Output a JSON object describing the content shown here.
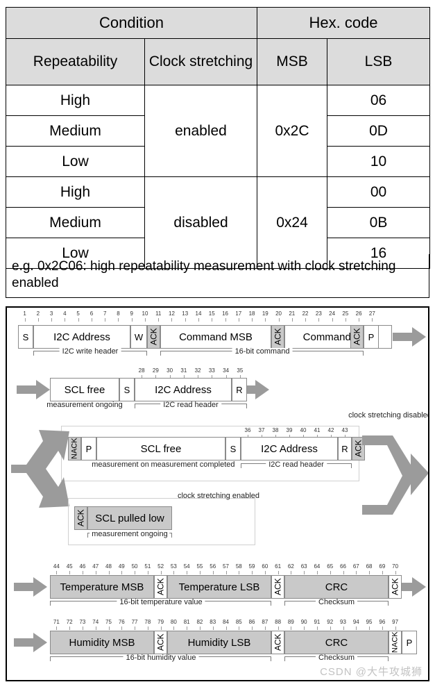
{
  "table": {
    "group_headers": [
      "Condition",
      "Hex. code"
    ],
    "column_headers": [
      "Repeatability",
      "Clock stretching",
      "MSB",
      "LSB"
    ],
    "rows": [
      {
        "repeatability": "High",
        "clock_stretching": "enabled",
        "msb": "0x2C",
        "lsb": "06"
      },
      {
        "repeatability": "Medium",
        "clock_stretching": "enabled",
        "msb": "0x2C",
        "lsb": "0D"
      },
      {
        "repeatability": "Low",
        "clock_stretching": "enabled",
        "msb": "0x2C",
        "lsb": "10"
      },
      {
        "repeatability": "High",
        "clock_stretching": "disabled",
        "msb": "0x24",
        "lsb": "00"
      },
      {
        "repeatability": "Medium",
        "clock_stretching": "disabled",
        "msb": "0x24",
        "lsb": "0B"
      },
      {
        "repeatability": "Low",
        "clock_stretching": "disabled",
        "msb": "0x24",
        "lsb": "16"
      }
    ],
    "note": "e.g. 0x2C06: high repeatability measurement with clock stretching enabled"
  },
  "diagram": {
    "row1": {
      "blocks": [
        "S",
        "I2C Address",
        "W",
        "ACK",
        "Command MSB",
        "ACK",
        "Command LSB",
        "ACK",
        "P"
      ],
      "bit_numbers": [
        "1",
        "2",
        "3",
        "4",
        "5",
        "6",
        "7",
        "8",
        "9",
        "10",
        "11",
        "12",
        "13",
        "14",
        "15",
        "16",
        "17",
        "18",
        "19",
        "20",
        "21",
        "22",
        "23",
        "24",
        "25",
        "26",
        "27"
      ],
      "brace_left": "I2C write header",
      "brace_right": "16-bit command"
    },
    "row2": {
      "blocks": [
        "SCL free",
        "S",
        "I2C Address",
        "R"
      ],
      "bit_numbers": [
        "28",
        "29",
        "30",
        "31",
        "32",
        "33",
        "34",
        "35"
      ],
      "brace_left": "measurement ongoing",
      "brace_right": "I2C read header"
    },
    "row3": {
      "blocks": [
        "NACK",
        "P",
        "SCL free",
        "S",
        "I2C Address",
        "R",
        "ACK"
      ],
      "bit_numbers": [
        "36",
        "37",
        "38",
        "39",
        "40",
        "41",
        "42",
        "43"
      ],
      "brace_a": "measurement ongoing",
      "brace_b": "measurement completed",
      "brace_c": "I2C read header",
      "callout": "clock stretching disabled"
    },
    "row4": {
      "blocks": [
        "ACK",
        "SCL pulled low"
      ],
      "brace_a": "measurement ongoing",
      "callout": "clock stretching enabled"
    },
    "row5": {
      "blocks": [
        "Temperature MSB",
        "ACK",
        "Temperature LSB",
        "ACK",
        "CRC",
        "ACK"
      ],
      "bit_numbers": [
        "44",
        "45",
        "46",
        "47",
        "48",
        "49",
        "50",
        "51",
        "52",
        "53",
        "54",
        "55",
        "56",
        "57",
        "58",
        "59",
        "60",
        "61",
        "62",
        "63",
        "64",
        "65",
        "66",
        "67",
        "68",
        "69",
        "70"
      ],
      "brace_left": "16-bit temperature value",
      "brace_right": "Checksum"
    },
    "row6": {
      "blocks": [
        "Humidity MSB",
        "ACK",
        "Humidity LSB",
        "ACK",
        "CRC",
        "NACK",
        "P"
      ],
      "bit_numbers": [
        "71",
        "72",
        "73",
        "74",
        "75",
        "76",
        "77",
        "78",
        "79",
        "80",
        "81",
        "82",
        "83",
        "84",
        "85",
        "86",
        "87",
        "88",
        "89",
        "90",
        "91",
        "92",
        "93",
        "94",
        "95",
        "96",
        "97"
      ],
      "brace_left": "16-bit humidity value",
      "brace_right": "Checksum"
    }
  },
  "watermark": "CSDN @大牛攻城狮"
}
